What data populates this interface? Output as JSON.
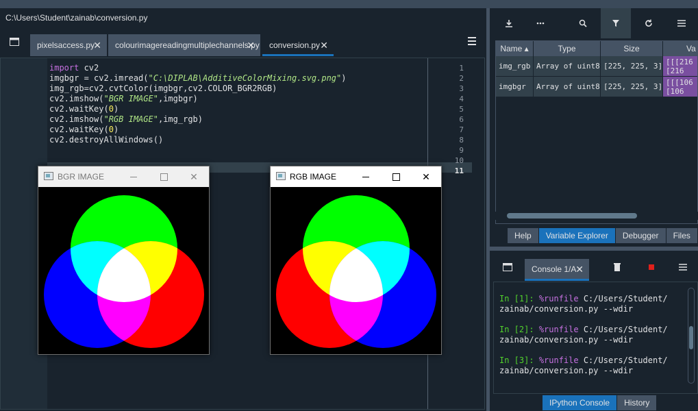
{
  "window": {
    "path": "C:\\Users\\Student\\zainab\\conversion.py"
  },
  "editor": {
    "tabs": [
      {
        "label": "pixelsaccess.py",
        "close": "✕"
      },
      {
        "label": "colourimagereadingmultiplechannels.py",
        "close": "✕"
      },
      {
        "label": "conversion.py",
        "close": "✕"
      }
    ],
    "active_tab": "conversion.py",
    "line_numbers": [
      "1",
      "2",
      "3",
      "4",
      "5",
      "6",
      "7",
      "8",
      "9",
      "10",
      "11"
    ],
    "current_line": "11",
    "code": {
      "l1_kw": "import",
      "l1_rest": " cv2",
      "l2_a": "imgbgr = cv2.imread(",
      "l2_str": "\"C:\\DIPLAB\\AdditiveColorMixing.svg.png\"",
      "l2_b": ")",
      "l3": "img_rgb=cv2.cvtColor(imgbgr,cv2.COLOR_BGR2RGB)",
      "l4_a": "cv2.imshow(",
      "l4_str": "\"BGR IMAGE\"",
      "l4_b": ",imgbgr)",
      "l5_a": "cv2.waitKey(",
      "l5_num": "0",
      "l5_b": ")",
      "l6_a": "cv2.imshow(",
      "l6_str": "\"RGB IMAGE\"",
      "l6_b": ",img_rgb)",
      "l7_a": "cv2.waitKey(",
      "l7_num": "0",
      "l7_b": ")",
      "l8": "cv2.destroyAllWindows()"
    }
  },
  "image_windows": [
    {
      "title": "BGR IMAGE",
      "top_color": "#00ff00",
      "left_color": "#0000ff",
      "right_color": "#ff0000",
      "tl_overlap": "#00ffff",
      "tr_overlap": "#ffff00",
      "bottom_overlap": "#ff00ff"
    },
    {
      "title": "RGB IMAGE",
      "top_color": "#00ff00",
      "left_color": "#ff0000",
      "right_color": "#0000ff",
      "tl_overlap": "#ffff00",
      "tr_overlap": "#00ffff",
      "bottom_overlap": "#ff00ff"
    }
  ],
  "variable_explorer": {
    "columns": [
      "Name",
      "Type",
      "Size",
      "Va"
    ],
    "rows": [
      {
        "name": "img_rgb",
        "type": "Array of uint8",
        "size": "[225, 225, 3]",
        "value_1": "[[[216",
        "value_2": "  [216"
      },
      {
        "name": "imgbgr",
        "type": "Array of uint8",
        "size": "[225, 225, 3]",
        "value_1": "[[[106",
        "value_2": "  [106"
      }
    ],
    "pane_tabs": [
      "Help",
      "Variable Explorer",
      "Debugger",
      "Files"
    ],
    "active_pane_tab": "Variable Explorer"
  },
  "console": {
    "tab_label": "Console 1/A",
    "close": "✕",
    "entries": [
      {
        "prompt": "In [1]:",
        "magic": "%runfile",
        "cmd": " C:/Users/Student/",
        "cont": "zainab/conversion.py --wdir"
      },
      {
        "prompt": "In [2]:",
        "magic": "%runfile",
        "cmd": " C:/Users/Student/",
        "cont": "zainab/conversion.py --wdir"
      },
      {
        "prompt": "In [3]:",
        "magic": "%runfile",
        "cmd": " C:/Users/Student/",
        "cont": "zainab/conversion.py --wdir"
      }
    ],
    "bottom_tabs": [
      "IPython Console",
      "History"
    ],
    "active_bottom_tab": "IPython Console"
  },
  "colors": {
    "accent": "#1a72bb",
    "background": "#19232d",
    "panel": "#455364"
  }
}
